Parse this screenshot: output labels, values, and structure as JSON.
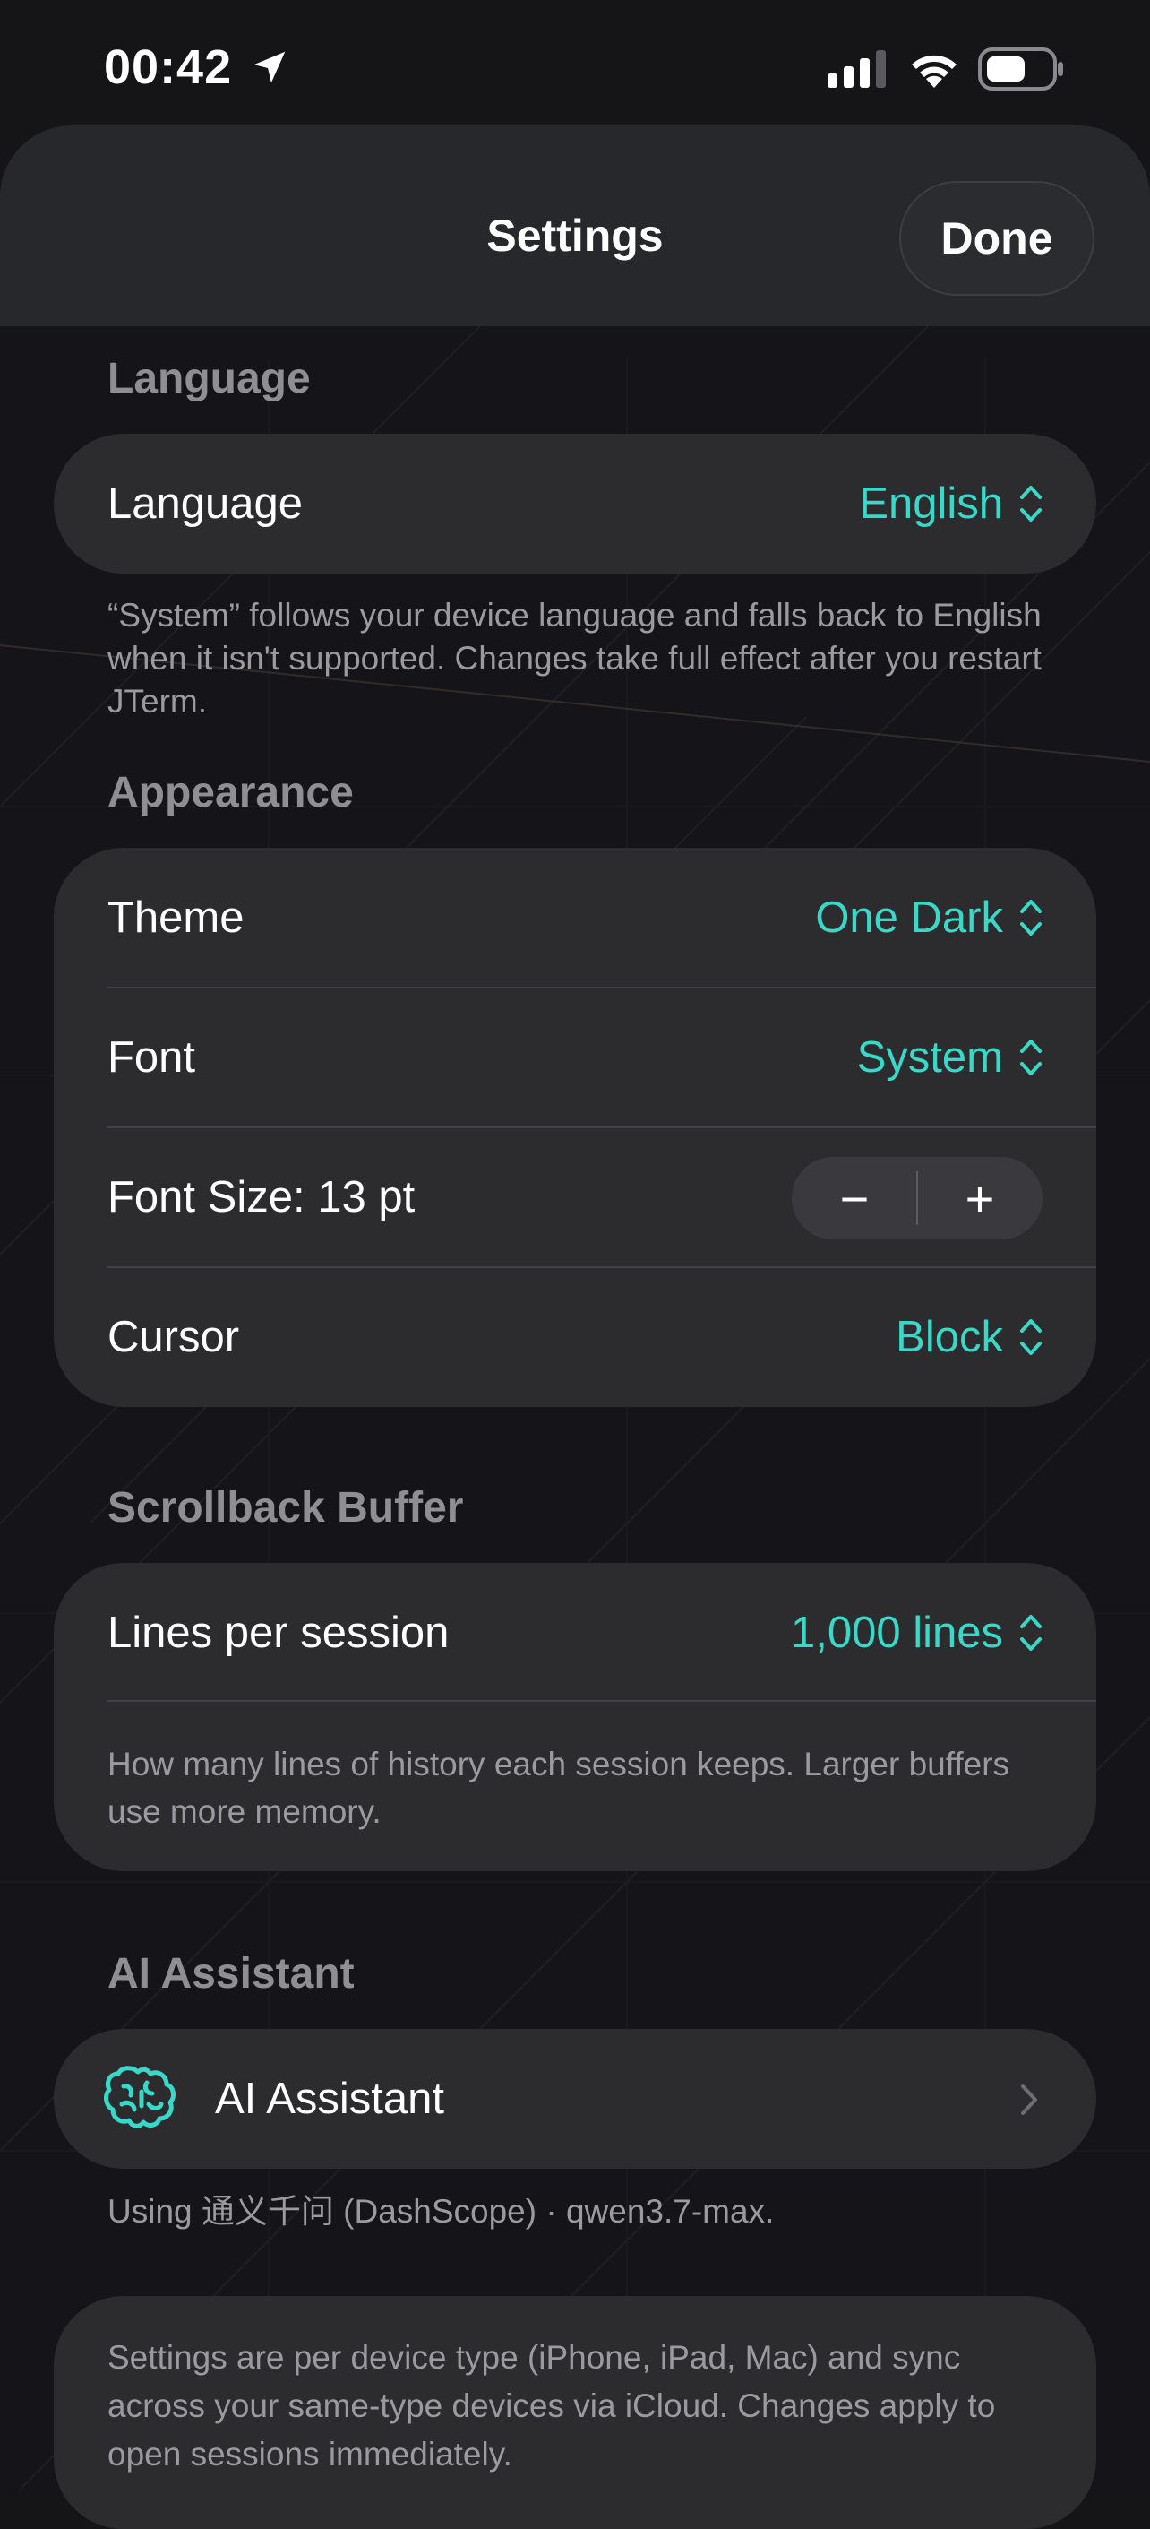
{
  "status_bar": {
    "time": "00:42",
    "icons": [
      "location-arrow-icon",
      "cellular-signal-icon",
      "wifi-icon",
      "battery-icon"
    ]
  },
  "nav": {
    "title": "Settings",
    "done_label": "Done"
  },
  "sections": {
    "language": {
      "header": "Language",
      "row": {
        "label": "Language",
        "value": "English"
      },
      "footnote": "“System” follows your device language and falls back to English when it isn't supported. Changes take full effect after you restart JTerm."
    },
    "appearance": {
      "header": "Appearance",
      "theme": {
        "label": "Theme",
        "value": "One Dark"
      },
      "font": {
        "label": "Font",
        "value": "System"
      },
      "font_size": {
        "label": "Font Size: 13 pt",
        "minus": "−",
        "plus": "+"
      },
      "cursor": {
        "label": "Cursor",
        "value": "Block"
      }
    },
    "scrollback": {
      "header": "Scrollback Buffer",
      "lines": {
        "label": "Lines per session",
        "value": "1,000 lines"
      },
      "note": "How many lines of history each session keeps. Larger buffers use more memory."
    },
    "ai": {
      "header": "AI Assistant",
      "row": {
        "label": "AI Assistant",
        "icon": "brain-icon"
      },
      "footnote": "Using 通义千问 (DashScope) · qwen3.7-max."
    },
    "sync_note": "Settings are per device type (iPhone, iPad, Mac) and sync across your same-type devices via iCloud. Changes apply to open sessions immediately."
  },
  "colors": {
    "accent": "#3ad8c8",
    "background": "#151518",
    "card": "#2c2c2e",
    "section_header": "#8e8e93"
  }
}
